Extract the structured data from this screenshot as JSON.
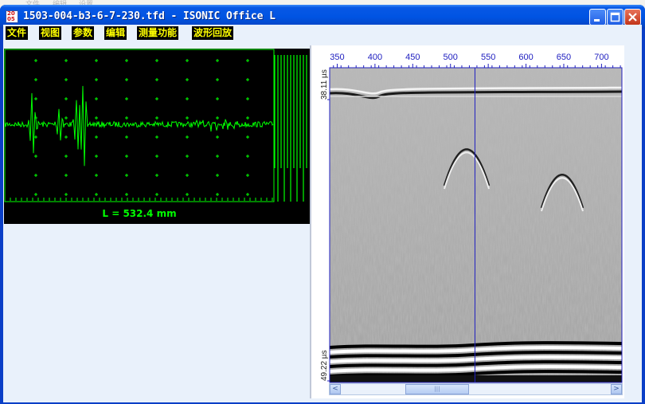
{
  "window": {
    "title": "1503-004-b3-6-7-230.tfd - ISONIC Office L",
    "icon_text_top": "20",
    "icon_text_bottom": "05"
  },
  "background_menu": [
    "文件",
    "编辑",
    "设置"
  ],
  "titlebar_buttons": [
    "minimize-icon",
    "maximize-icon",
    "close-icon"
  ],
  "menu": {
    "items": [
      "文件",
      "视图",
      "参数",
      "编辑",
      "测量功能",
      "波形回放"
    ]
  },
  "ascan": {
    "readout": "L = 532.4 mm",
    "trace_color": "#00ff00",
    "background": "#000000"
  },
  "bscan": {
    "x_ticks": [
      "350",
      "400",
      "450",
      "500",
      "550",
      "600",
      "650",
      "700"
    ],
    "y_top_label": "38.11 µs",
    "y_bottom_label": "49.22 µs",
    "cursor_position": 532.4,
    "axis_color": "#2020c0"
  },
  "scrollbar": {
    "left_arrow": "<",
    "right_arrow": ">",
    "thumb_grip": "|||"
  }
}
